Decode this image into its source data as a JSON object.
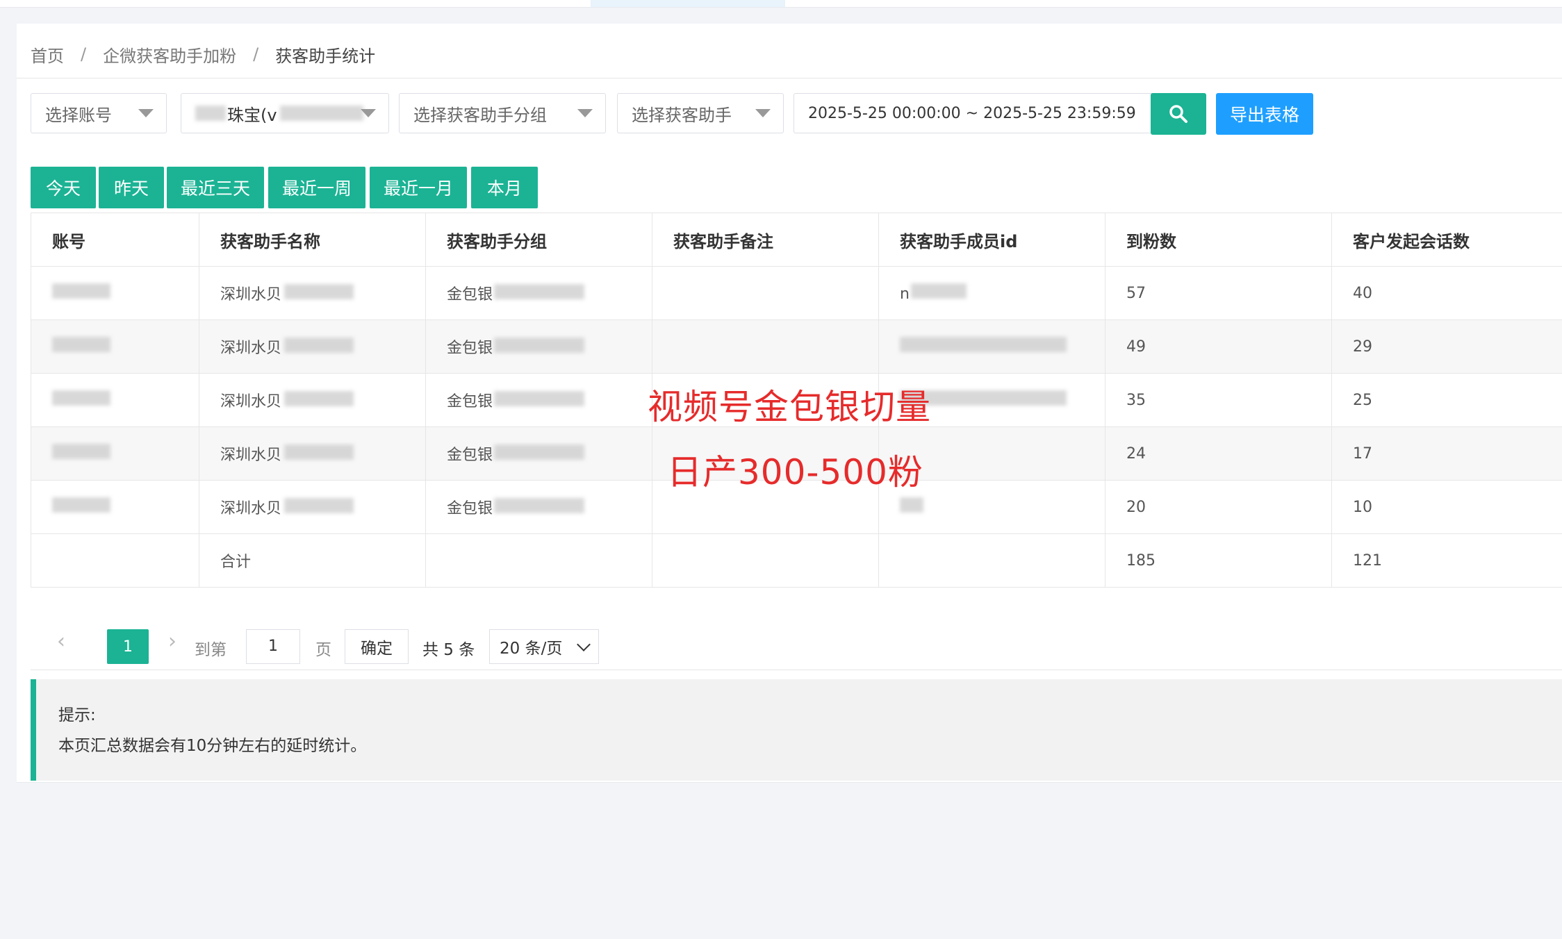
{
  "breadcrumb": {
    "items": [
      "首页",
      "企微获客助手加粉",
      "获客助手统计"
    ],
    "separator": "/"
  },
  "filters": {
    "account_placeholder": "选择账号",
    "corp_value": "珠宝(v",
    "group_placeholder": "选择获客助手分组",
    "assistant_placeholder": "选择获客助手",
    "date_range": "2025-5-25 00:00:00 ~ 2025-5-25 23:59:59",
    "search_icon": "search-icon",
    "export_label": "导出表格"
  },
  "quick_dates": [
    "今天",
    "昨天",
    "最近三天",
    "最近一周",
    "最近一月",
    "本月"
  ],
  "table": {
    "columns": [
      "账号",
      "获客助手名称",
      "获客助手分组",
      "获客助手备注",
      "获客助手成员id",
      "到粉数",
      "客户发起会话数"
    ],
    "rows": [
      {
        "name": "深圳水贝",
        "group": "金包银",
        "member": "n",
        "fans": "57",
        "sessions": "40"
      },
      {
        "name": "深圳水贝",
        "group": "金包银",
        "member": "",
        "fans": "49",
        "sessions": "29"
      },
      {
        "name": "深圳水贝",
        "group": "金包银",
        "member": "",
        "fans": "35",
        "sessions": "25"
      },
      {
        "name": "深圳水贝",
        "group": "金包银",
        "member": "",
        "fans": "24",
        "sessions": "17"
      },
      {
        "name": "深圳水贝",
        "group": "金包银",
        "member": "",
        "fans": "20",
        "sessions": "10"
      }
    ],
    "total": {
      "label": "合计",
      "fans": "185",
      "sessions": "121"
    }
  },
  "pager": {
    "current_page": "1",
    "goto_label": "到第",
    "goto_value": "1",
    "page_label": "页",
    "confirm_label": "确定",
    "total_label": "共 5 条",
    "page_size": "20 条/页"
  },
  "tip": {
    "title": "提示:",
    "text": "本页汇总数据会有10分钟左右的延时统计。"
  },
  "overlay": {
    "line1": "视频号金包银切量",
    "line2": "日产300-500粉"
  },
  "colors": {
    "primary": "#1bb394",
    "export": "#1e9fff",
    "overlay": "#e62b2b"
  }
}
